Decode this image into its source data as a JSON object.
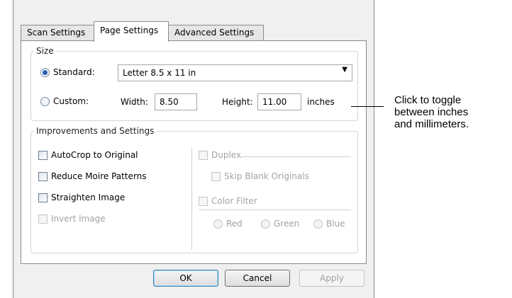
{
  "tabs": [
    {
      "label": "Scan Settings",
      "active": false
    },
    {
      "label": "Page Settings",
      "active": true
    },
    {
      "label": "Advanced Settings",
      "active": false
    }
  ],
  "size": {
    "legend": "Size",
    "standard_label": "Standard:",
    "standard_selected": true,
    "standard_value": "Letter 8.5 x 11 in",
    "custom_label": "Custom:",
    "width_label": "Width:",
    "width_value": "8.50",
    "height_label": "Height:",
    "height_value": "11.00",
    "units_label": "inches"
  },
  "improvements": {
    "legend": "Improvements and Settings",
    "autocrop": "AutoCrop to Original",
    "reduce_moire": "Reduce Moire Patterns",
    "straighten": "Straighten Image",
    "invert": "Invert Image",
    "duplex": "Duplex",
    "skip_blank": "Skip Blank Originals",
    "color_filter": "Color Filter",
    "red": "Red",
    "green": "Green",
    "blue": "Blue"
  },
  "buttons": {
    "ok": "OK",
    "cancel": "Cancel",
    "apply": "Apply"
  },
  "callout": {
    "line1": "Click to toggle",
    "line2": "between inches",
    "line3": "and millimeters."
  },
  "colors": {
    "accent": "#3c7fb1",
    "disabled_text": "#a3a3a3"
  },
  "icons": {
    "dropdown": "chevron-down-icon"
  }
}
